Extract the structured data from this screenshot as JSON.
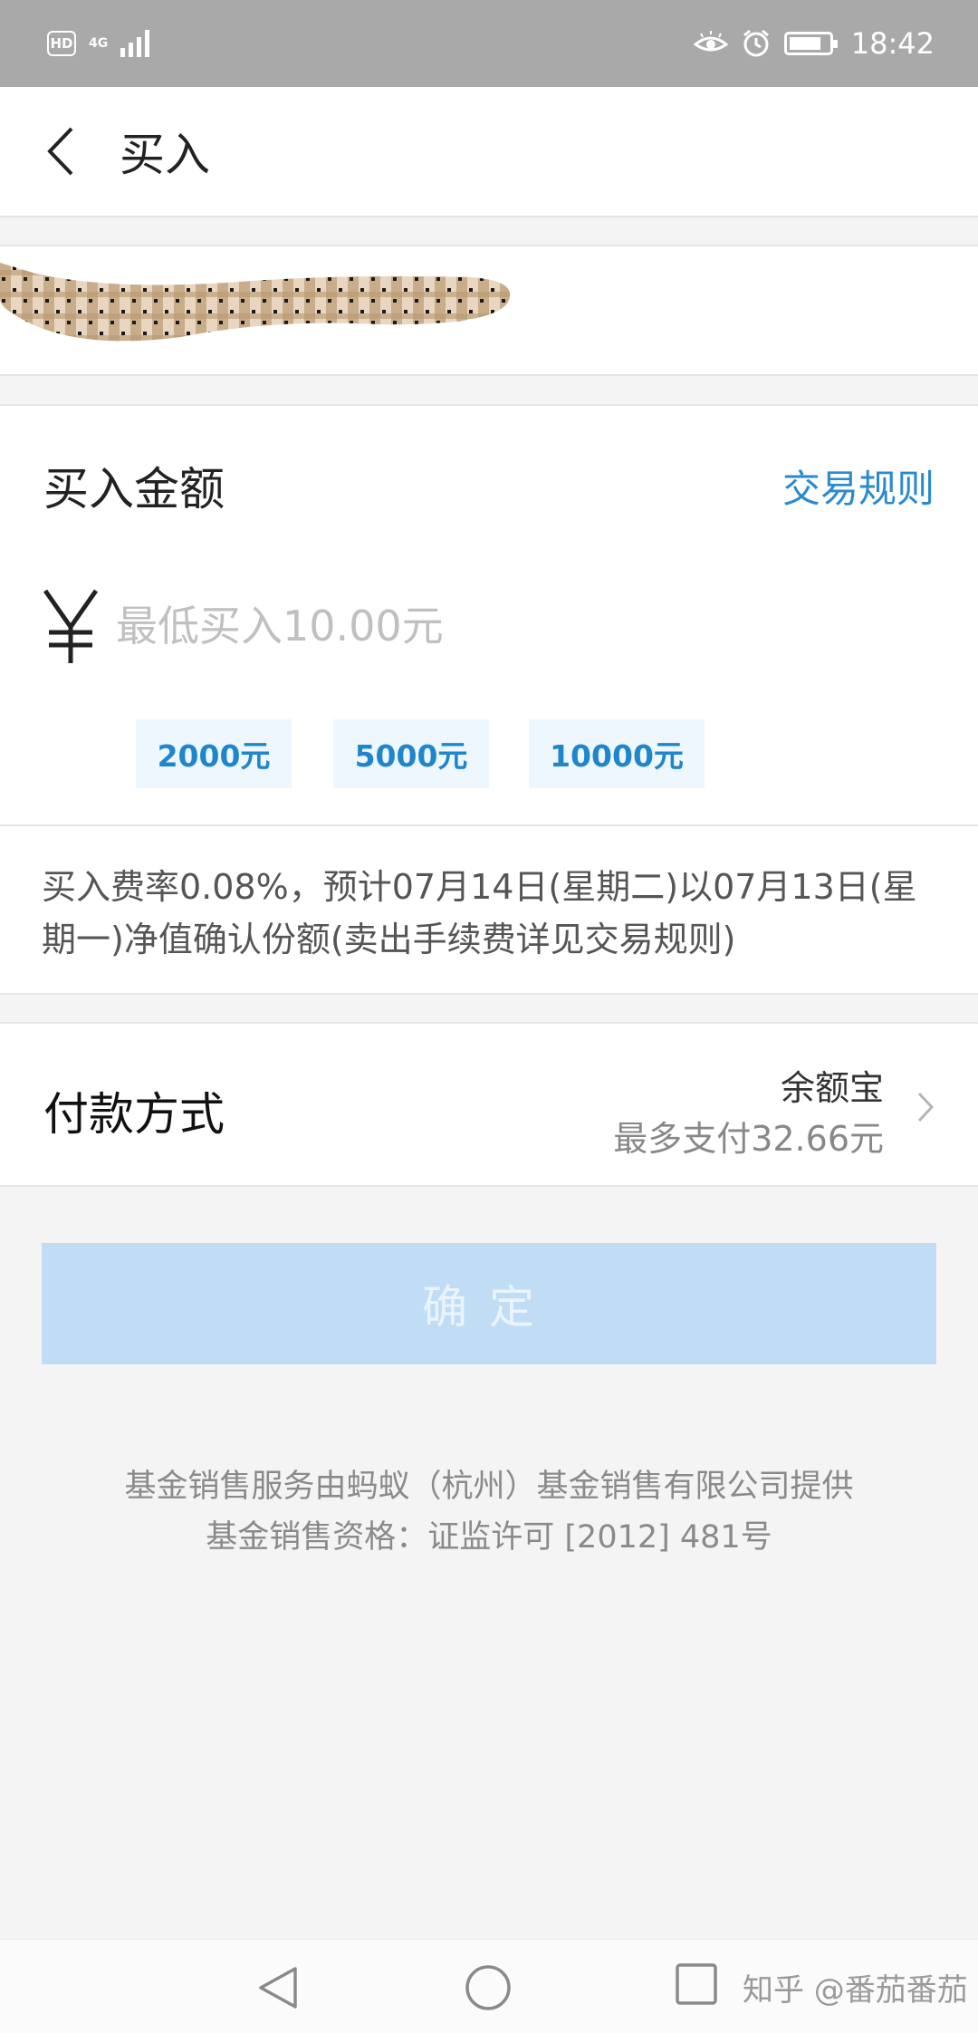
{
  "status_bar": {
    "hd_label": "HD",
    "network_label": "4G",
    "time": "18:42",
    "icons": [
      "eye-icon",
      "alarm-icon",
      "battery-icon"
    ]
  },
  "header": {
    "back_icon": "chevron-left-icon",
    "title": "买入"
  },
  "fund": {
    "name_redacted": true
  },
  "amount": {
    "label": "买入金额",
    "rules_link": "交易规则",
    "currency_symbol": "¥",
    "placeholder": "最低买入10.00元",
    "value": "",
    "quick_amounts": [
      "2000元",
      "5000元",
      "10000元"
    ]
  },
  "fee_note": "买入费率0.08%，预计07月14日(星期二)以07月13日(星期一)净值确认份额(卖出手续费详见交易规则)",
  "payment": {
    "label": "付款方式",
    "method": "余额宝",
    "limit": "最多支付32.66元"
  },
  "confirm_button": "确定",
  "footer": {
    "line1": "基金销售服务由蚂蚁（杭州）基金销售有限公司提供",
    "line2": "基金销售资格：证监许可 [2012] 481号"
  },
  "nav_bar": {
    "watermark": "知乎 @番茄番茄"
  },
  "colors": {
    "accent": "#2a8ad0",
    "quick_bg": "#eef6fe",
    "confirm_disabled": "#c0ddf5",
    "status_bar": "#a9a9a9"
  }
}
